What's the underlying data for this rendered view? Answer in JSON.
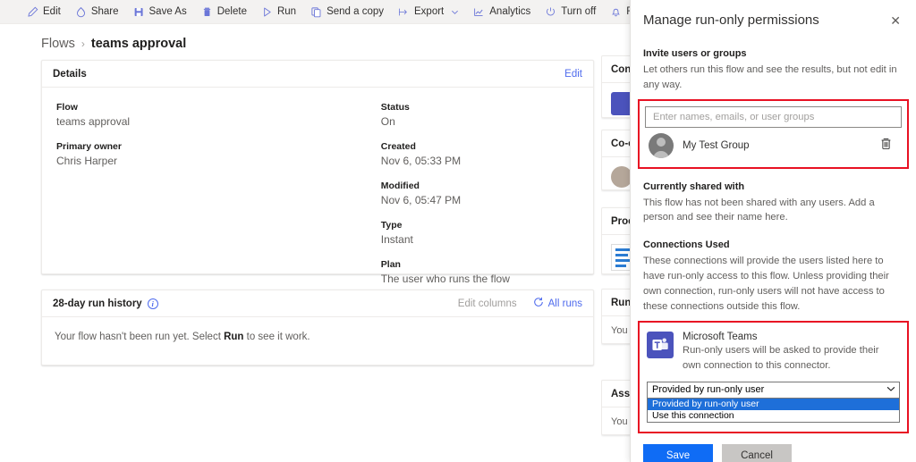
{
  "commandbar": {
    "items": [
      {
        "icon": "pencil-icon",
        "label": "Edit"
      },
      {
        "icon": "share-icon",
        "label": "Share"
      },
      {
        "icon": "save-as-icon",
        "label": "Save As"
      },
      {
        "icon": "trash-icon",
        "label": "Delete"
      },
      {
        "icon": "play-icon",
        "label": "Run"
      },
      {
        "icon": "copy-icon",
        "label": "Send a copy"
      },
      {
        "icon": "export-icon",
        "label": "Export",
        "chevron": true
      },
      {
        "icon": "analytics-icon",
        "label": "Analytics"
      },
      {
        "icon": "power-icon",
        "label": "Turn off"
      },
      {
        "icon": "bell-icon",
        "label": "Repair tips off"
      }
    ]
  },
  "breadcrumb": {
    "root": "Flows",
    "separator": "›",
    "current": "teams approval"
  },
  "details_card": {
    "title": "Details",
    "edit_label": "Edit",
    "left_fields": [
      {
        "label": "Flow",
        "value": "teams approval"
      },
      {
        "label": "Primary owner",
        "value": "Chris Harper"
      }
    ],
    "right_fields": [
      {
        "label": "Status",
        "value": "On"
      },
      {
        "label": "Created",
        "value": "Nov 6, 05:33 PM"
      },
      {
        "label": "Modified",
        "value": "Nov 6, 05:47 PM"
      },
      {
        "label": "Type",
        "value": "Instant"
      },
      {
        "label": "Plan",
        "value": "The user who runs the flow"
      }
    ]
  },
  "run_history_card": {
    "title": "28-day run history",
    "info_glyph": "i",
    "edit_columns_label": "Edit columns",
    "all_runs_label": "All runs",
    "empty_text_before": "Your flow hasn't been run yet. Select ",
    "empty_text_bold": "Run",
    "empty_text_after": " to see it work."
  },
  "mid_column": {
    "cards": [
      {
        "title": "Connections",
        "visible": "Con"
      },
      {
        "title": "Co-owners",
        "visible": "Co-"
      },
      {
        "title": "Process advisor",
        "visible": "Pro"
      },
      {
        "title": "Run only users",
        "visible": "Run",
        "body": "You"
      },
      {
        "title": "Associated apps",
        "visible": "Ass",
        "body": "You"
      }
    ]
  },
  "panel": {
    "title": "Manage run-only permissions",
    "close_glyph": "✕",
    "invite": {
      "heading": "Invite users or groups",
      "description": "Let others run this flow and see the results, but not edit in any way.",
      "input_placeholder": "Enter names, emails, or user groups",
      "input_value": "",
      "people": [
        {
          "name": "My Test Group",
          "delete_icon": "trash-icon"
        }
      ]
    },
    "currently_shared": {
      "heading": "Currently shared with",
      "description": "This flow has not been shared with any users. Add a person and see their name here."
    },
    "connections_used": {
      "heading": "Connections Used",
      "description": "These connections will provide the users listed here to have run-only access to this flow. Unless providing their own connection, run-only users will not have access to these connections outside this flow.",
      "connector": {
        "icon": "microsoft-teams-icon",
        "name": "Microsoft Teams",
        "description": "Run-only users will be asked to provide their own connection to this connector.",
        "dropdown": {
          "selected": "Provided by run-only user",
          "open": true,
          "options": [
            "Provided by run-only user",
            "Use this connection"
          ]
        }
      }
    },
    "actions": {
      "save_label": "Save",
      "cancel_label": "Cancel"
    }
  },
  "colors": {
    "accent_blue": "#4f6bed",
    "primary_button": "#0f6cf5",
    "highlight_red": "#e81123",
    "teams_purple": "#4b53bc",
    "select_highlight": "#1e6fd9"
  }
}
